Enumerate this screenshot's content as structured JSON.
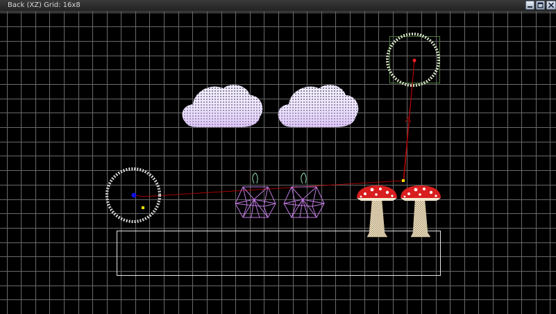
{
  "window": {
    "title": "Back (XZ) Grid: 16x8",
    "buttons": [
      "minimize-icon",
      "maximize-icon",
      "close-icon"
    ]
  },
  "viewport": {
    "view": "Back (XZ)",
    "grid": "16x8",
    "colors": {
      "background": "#000000",
      "grid": "#6a6a6a",
      "path": "#a80000",
      "selection_box": "#4d7a3a",
      "handle": "#ffe000",
      "camera_dot": "#1010e0",
      "target_dot": "#ff2020",
      "cloud_mesh": "#e8dcff",
      "gem_mesh": "#c07ae0",
      "gem_stem": "#90e0b0",
      "mushroom_cap": "#d81e1e",
      "mushroom_spots": "#ffffff",
      "mushroom_stem": "#e8dcb8",
      "ground_outline": "#e8e8e8"
    },
    "objects": [
      "camera-ring-icon",
      "target-ring-icon",
      "cloud-icon",
      "cloud-icon",
      "gem-mesh-icon",
      "gem-mesh-icon",
      "mushroom-icon",
      "mushroom-icon",
      "ground-plane-outline"
    ]
  }
}
